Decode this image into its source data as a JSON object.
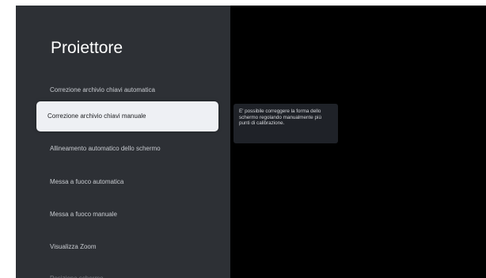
{
  "panel": {
    "title": "Proiettore",
    "items": [
      {
        "label": "Correzione archivio chiavi automatica"
      },
      {
        "label": "Correzione archivio chiavi manuale"
      },
      {
        "label": "Allineamento automatico dello schermo"
      },
      {
        "label": "Messa a fuoco automatica"
      },
      {
        "label": "Messa a fuoco manuale"
      },
      {
        "label": "Visualizza Zoom"
      },
      {
        "label": "Posizione schermo"
      }
    ],
    "selected_index": 1
  },
  "tooltip": {
    "text": "E' possibile correggere la forma dello schermo regolando manualmente più punti di calibrazione."
  },
  "colors": {
    "panel_background": "#2d3035",
    "screen_background": "#000000",
    "selected_background": "#eef0f4",
    "tooltip_background": "#1f2228"
  }
}
